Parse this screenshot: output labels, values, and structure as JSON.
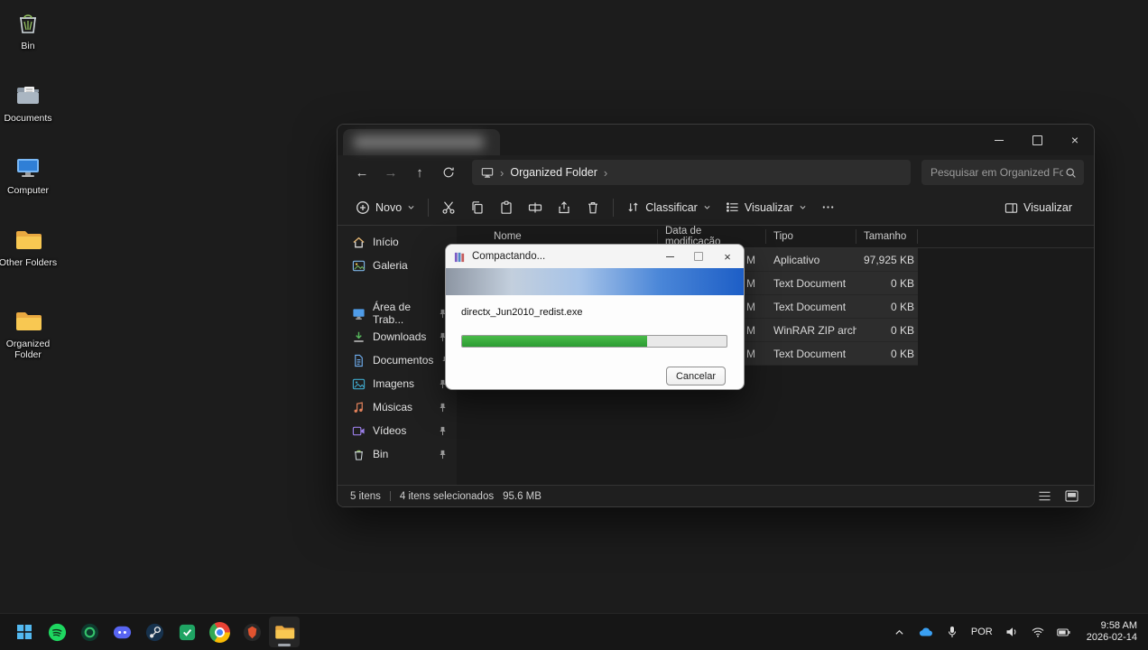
{
  "desktop": {
    "icons": [
      {
        "label": "Bin",
        "icon": "recycle-bin"
      },
      {
        "label": "Documents",
        "icon": "documents-folder"
      },
      {
        "label": "Computer",
        "icon": "computer"
      },
      {
        "label": "Other Folders",
        "icon": "folder"
      },
      {
        "label": "Organized Folder",
        "icon": "folder"
      }
    ]
  },
  "explorer": {
    "nav": {
      "breadcrumb": "Organized Folder",
      "search_placeholder": "Pesquisar em Organized Fo"
    },
    "toolbar": {
      "new": "Novo",
      "sort": "Classificar",
      "view": "Visualizar",
      "details": "Visualizar"
    },
    "sidebar": {
      "top": [
        {
          "label": "Início",
          "icon": "home"
        },
        {
          "label": "Galeria",
          "icon": "gallery"
        }
      ],
      "pinned": [
        {
          "label": "Área de Trab...",
          "icon": "desktop"
        },
        {
          "label": "Downloads",
          "icon": "downloads"
        },
        {
          "label": "Documentos",
          "icon": "documents"
        },
        {
          "label": "Imagens",
          "icon": "pictures"
        },
        {
          "label": "Músicas",
          "icon": "music"
        },
        {
          "label": "Vídeos",
          "icon": "videos"
        },
        {
          "label": "Bin",
          "icon": "recycle-bin"
        }
      ]
    },
    "columns": [
      "Nome",
      "Data de modificação",
      "Tipo",
      "Tamanho"
    ],
    "rows": [
      {
        "date": "M",
        "tipo": "Aplicativo",
        "tamanho": "97,925 KB"
      },
      {
        "date": "M",
        "tipo": "Text Document",
        "tamanho": "0 KB"
      },
      {
        "date": "M",
        "tipo": "Text Document",
        "tamanho": "0 KB"
      },
      {
        "date": "M",
        "tipo": "WinRAR ZIP archive",
        "tamanho": "0 KB"
      },
      {
        "date": "M",
        "tipo": "Text Document",
        "tamanho": "0 KB"
      }
    ],
    "status": {
      "count": "5 itens",
      "selected": "4 itens selecionados",
      "size": "95.6 MB"
    }
  },
  "dialog": {
    "title": "Compactando...",
    "filename": "directx_Jun2010_redist.exe",
    "progress_percent": 70,
    "cancel": "Cancelar"
  },
  "taskbar": {
    "language": "POR",
    "clock": {
      "time": "9:58 AM",
      "date": "2026-02-14"
    }
  },
  "colors": {
    "progress_green": "#2fa83c",
    "banner_blue": "#1d5ec6",
    "folder_yellow": "#f8c852"
  }
}
